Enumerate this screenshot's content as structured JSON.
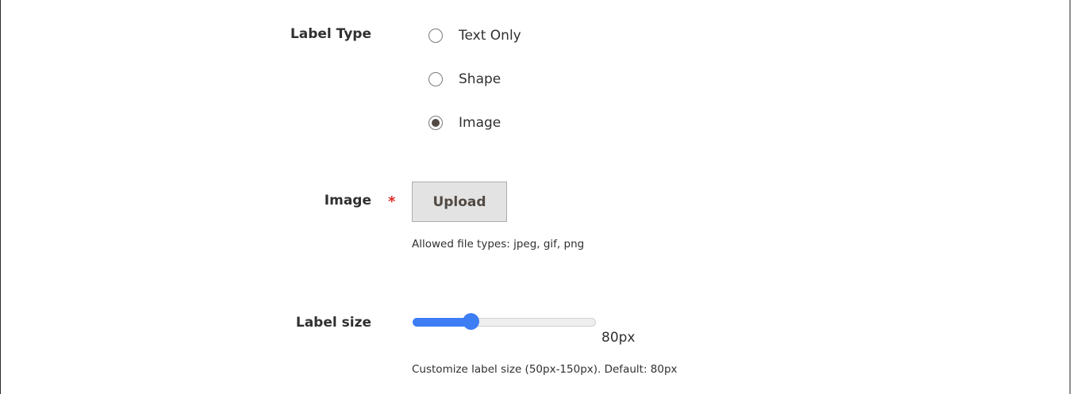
{
  "label_type": {
    "label": "Label Type",
    "options": [
      {
        "label": "Text Only",
        "checked": false
      },
      {
        "label": "Shape",
        "checked": false
      },
      {
        "label": "Image",
        "checked": true
      }
    ]
  },
  "image": {
    "label": "Image",
    "required_mark": "*",
    "upload_label": "Upload",
    "note": "Allowed file types: jpeg, gif, png"
  },
  "label_size": {
    "label": "Label size",
    "value_text": "80px",
    "min": 50,
    "max": 150,
    "value": 80,
    "note": "Customize label size (50px-150px). Default: 80px"
  },
  "colors": {
    "accent": "#3d7ef5",
    "required": "#e02b27",
    "button_bg": "#e3e3e3"
  }
}
